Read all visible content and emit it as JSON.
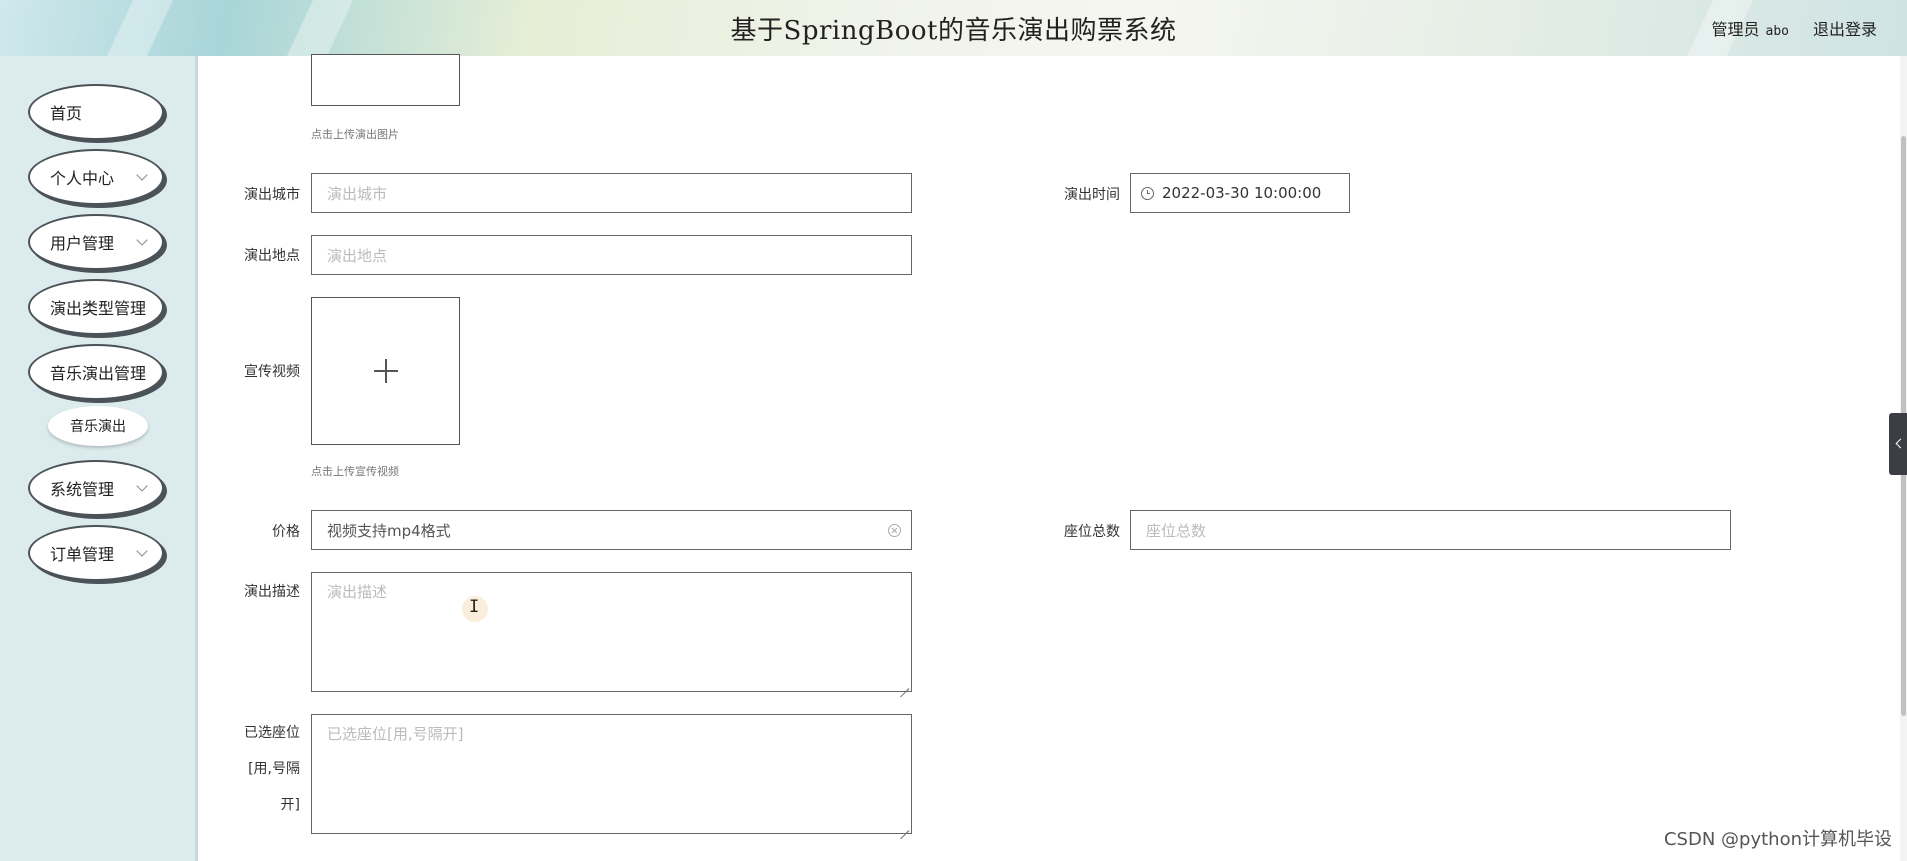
{
  "header": {
    "title": "基于SpringBoot的音乐演出购票系统",
    "user_label": "管理员",
    "user_name": "abo",
    "logout": "退出登录"
  },
  "sidebar": {
    "items": [
      {
        "label": "首页"
      },
      {
        "label": "个人中心"
      },
      {
        "label": "用户管理"
      },
      {
        "label": "演出类型管理"
      },
      {
        "label": "音乐演出管理"
      },
      {
        "label": "音乐演出"
      },
      {
        "label": "系统管理"
      },
      {
        "label": "订单管理"
      }
    ]
  },
  "form": {
    "image_upload_hint": "点击上传演出图片",
    "city_label": "演出城市",
    "city_placeholder": "演出城市",
    "time_label": "演出时间",
    "time_value": "2022-03-30 10:00:00",
    "venue_label": "演出地点",
    "venue_placeholder": "演出地点",
    "video_label": "宣传视频",
    "video_upload_hint": "点击上传宣传视频",
    "price_label": "价格",
    "price_value": "视频支持mp4格式",
    "seats_label": "座位总数",
    "seats_placeholder": "座位总数",
    "desc_label": "演出描述",
    "desc_placeholder": "演出描述",
    "selected_label_line1": "已选座位",
    "selected_label_line2": "[用,号隔",
    "selected_label_line3": "开]",
    "selected_placeholder": "已选座位[用,号隔开]"
  },
  "watermark": "CSDN @python计算机毕设"
}
